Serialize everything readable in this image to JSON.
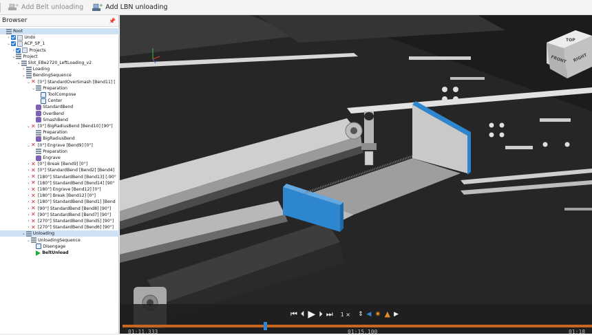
{
  "toolbar": {
    "add_belt_unloading": "Add Belt unloading",
    "add_lbn_unloading": "Add LBN unloading"
  },
  "browser": {
    "title": "Browser",
    "pin_icon": "pin-icon"
  },
  "tree": [
    {
      "label": "Root",
      "indent": 0,
      "arrow": "",
      "icon": "stack",
      "check": false,
      "selected": true
    },
    {
      "label": "Undo",
      "indent": 1,
      "arrow": ">",
      "icon": "page",
      "check": true
    },
    {
      "label": "ACP_SP_1",
      "indent": 1,
      "arrow": "v",
      "icon": "page",
      "check": true
    },
    {
      "label": "Projects",
      "indent": 2,
      "arrow": ">",
      "icon": "page",
      "check": true
    },
    {
      "label": "Project",
      "indent": 2,
      "arrow": "v",
      "icon": "stack",
      "check": false
    },
    {
      "label": "Slot_EBe2720_LeftLoading_v2",
      "indent": 3,
      "arrow": "v",
      "icon": "stack",
      "check": false
    },
    {
      "label": "Loading",
      "indent": 4,
      "arrow": ">",
      "icon": "stack",
      "check": false
    },
    {
      "label": "BendingSequence",
      "indent": 4,
      "arrow": "v",
      "icon": "stack",
      "check": false
    },
    {
      "label": "[0°] StandardOverSmash [Bend11] [",
      "indent": 5,
      "arrow": "v",
      "icon": "x",
      "check": false
    },
    {
      "label": "Preparation",
      "indent": 6,
      "arrow": "v",
      "icon": "stack",
      "check": false
    },
    {
      "label": "ToolCompose",
      "indent": 7,
      "arrow": "",
      "icon": "cube",
      "check": false
    },
    {
      "label": "Center",
      "indent": 7,
      "arrow": "",
      "icon": "cube",
      "check": false
    },
    {
      "label": "StandardBend",
      "indent": 6,
      "arrow": "",
      "icon": "bend",
      "check": false
    },
    {
      "label": "OverBend",
      "indent": 6,
      "arrow": "",
      "icon": "bend",
      "check": false
    },
    {
      "label": "SmashBend",
      "indent": 6,
      "arrow": "",
      "icon": "bend",
      "check": false
    },
    {
      "label": "[0°] BigRadiusBend [Bend10] [90°]",
      "indent": 5,
      "arrow": "v",
      "icon": "x",
      "check": false
    },
    {
      "label": "Preparation",
      "indent": 6,
      "arrow": "",
      "icon": "stack",
      "check": false
    },
    {
      "label": "BigRadiusBend",
      "indent": 6,
      "arrow": "",
      "icon": "bend",
      "check": false
    },
    {
      "label": "[0°] Engrave [Bend9] [0°]",
      "indent": 5,
      "arrow": "v",
      "icon": "x",
      "check": false
    },
    {
      "label": "Preparation",
      "indent": 6,
      "arrow": "",
      "icon": "stack",
      "check": false
    },
    {
      "label": "Engrave",
      "indent": 6,
      "arrow": "",
      "icon": "bend",
      "check": false
    },
    {
      "label": "[0°] Break [Bend9] [0°]",
      "indent": 5,
      "arrow": ">",
      "icon": "x",
      "check": false
    },
    {
      "label": "[0°] StandardBend [Bend2] [Bend4]",
      "indent": 5,
      "arrow": ">",
      "icon": "x",
      "check": false
    },
    {
      "label": "[180°] StandardBend [Bend13] [-90°",
      "indent": 5,
      "arrow": ">",
      "icon": "x",
      "check": false
    },
    {
      "label": "[180°] StandardBend [Bend14] [90°",
      "indent": 5,
      "arrow": ">",
      "icon": "x",
      "check": false
    },
    {
      "label": "[180°] Engrave [Bend12] [0°]",
      "indent": 5,
      "arrow": ">",
      "icon": "x",
      "check": false
    },
    {
      "label": "[180°] Break [Bend12] [0°]",
      "indent": 5,
      "arrow": ">",
      "icon": "x",
      "check": false
    },
    {
      "label": "[180°] StandardBend [Bend1] [Bend",
      "indent": 5,
      "arrow": ">",
      "icon": "x",
      "check": false
    },
    {
      "label": "[90°] StandardBend [Bend8] [90°]",
      "indent": 5,
      "arrow": ">",
      "icon": "x",
      "check": false
    },
    {
      "label": "[90°] StandardBend [Bend7] [90°]",
      "indent": 5,
      "arrow": ">",
      "icon": "x",
      "check": false
    },
    {
      "label": "[270°] StandardBend [Bend5] [90°]",
      "indent": 5,
      "arrow": ">",
      "icon": "x",
      "check": false
    },
    {
      "label": "[270°] StandardBend [Bend6] [90°]",
      "indent": 5,
      "arrow": ">",
      "icon": "x",
      "check": false
    },
    {
      "label": "Unloading",
      "indent": 4,
      "arrow": "v",
      "icon": "stack",
      "check": false,
      "selected": true
    },
    {
      "label": "UnloadingSequence",
      "indent": 5,
      "arrow": "v",
      "icon": "stack",
      "check": false
    },
    {
      "label": "Disengage",
      "indent": 6,
      "arrow": "",
      "icon": "cube",
      "check": false
    },
    {
      "label": "BeltUnload",
      "indent": 6,
      "arrow": "",
      "icon": "play",
      "check": false,
      "bold": true
    }
  ],
  "viewport": {
    "navcube": {
      "top": "TOP",
      "front": "FRONT",
      "right": "RIGHT"
    },
    "playback": {
      "speed": "1 ×",
      "first_icon": "skip-to-start-icon",
      "prev_icon": "step-back-icon",
      "play_icon": "play-icon",
      "next_icon": "step-forward-icon",
      "last_icon": "skip-to-end-icon"
    },
    "time_left": "01:11.333",
    "time_mid": "01:15.100",
    "time_right": "01:18"
  },
  "colors": {
    "accent": "#2f86d9",
    "timeline": "#c8651f",
    "part_blue": "#2e86cf"
  }
}
